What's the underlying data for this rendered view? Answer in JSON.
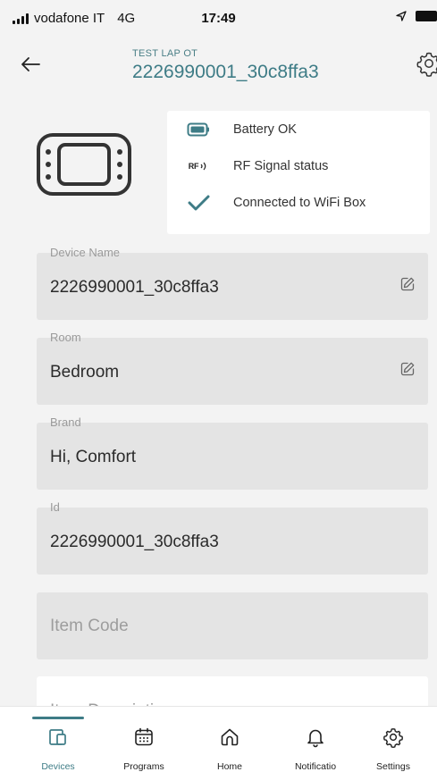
{
  "status_bar": {
    "carrier": "vodafone IT",
    "network": "4G",
    "time": "17:49"
  },
  "header": {
    "subtitle": "TEST LAP OT",
    "title": "2226990001_30c8ffa3"
  },
  "device_status": {
    "items": [
      {
        "icon": "battery-icon",
        "label": "Battery OK"
      },
      {
        "icon": "rf-signal-icon",
        "icon_text": "RF",
        "label": "RF Signal status"
      },
      {
        "icon": "check-icon",
        "label": "Connected to WiFi Box"
      }
    ]
  },
  "fields": {
    "device_name": {
      "label": "Device Name",
      "value": "2226990001_30c8ffa3"
    },
    "room": {
      "label": "Room",
      "value": "Bedroom"
    },
    "brand": {
      "label": "Brand",
      "value": "Hi, Comfort"
    },
    "id": {
      "label": "Id",
      "value": "2226990001_30c8ffa3"
    },
    "item_code": {
      "placeholder": "Item Code"
    },
    "item_description": {
      "placeholder": "Item Description"
    }
  },
  "bottom_nav": {
    "items": [
      {
        "label": "Devices",
        "icon": "devices-icon",
        "active": true
      },
      {
        "label": "Programs",
        "icon": "calendar-icon"
      },
      {
        "label": "Home",
        "icon": "home-icon"
      },
      {
        "label": "Notificatio",
        "icon": "bell-icon"
      },
      {
        "label": "Settings",
        "icon": "gear-icon"
      }
    ]
  },
  "colors": {
    "accent": "#3e7c86",
    "field_bg": "#e4e4e4",
    "page_bg": "#f3f3f3"
  }
}
